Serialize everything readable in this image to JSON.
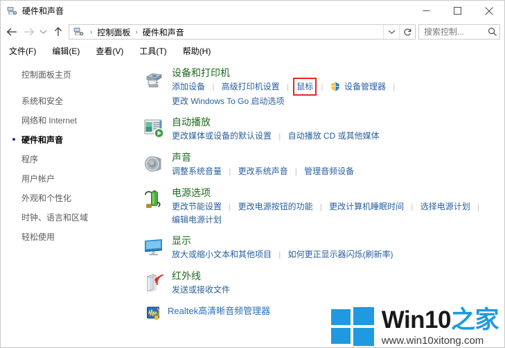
{
  "window": {
    "title": "硬件和声音",
    "title_icon": "devices-printers-icon",
    "controls": {
      "minimize": "minimize-icon",
      "maximize": "maximize-icon",
      "close": "close-icon"
    }
  },
  "addressbar": {
    "back": "back-arrow-icon",
    "forward": "forward-arrow-icon",
    "recent": "chevron-down-icon",
    "up": "up-arrow-icon",
    "crumb_icon": "devices-printers-icon",
    "crumbs": [
      "控制面板",
      "硬件和声音"
    ],
    "separator": "›",
    "dropdown": "chevron-down-icon",
    "refresh": "refresh-icon",
    "search": {
      "value": "",
      "placeholder": "搜索控制...",
      "icon": "search-icon"
    }
  },
  "menubar": {
    "items": [
      "文件(F)",
      "编辑(E)",
      "查看(V)",
      "工具(T)",
      "帮助(H)"
    ]
  },
  "sidebar": {
    "home": "控制面板主页",
    "items": [
      {
        "label": "系统和安全",
        "current": false
      },
      {
        "label": "网络和 Internet",
        "current": false
      },
      {
        "label": "硬件和声音",
        "current": true
      },
      {
        "label": "程序",
        "current": false
      },
      {
        "label": "用户帐户",
        "current": false
      },
      {
        "label": "外观和个性化",
        "current": false
      },
      {
        "label": "时钟、语言和区域",
        "current": false
      },
      {
        "label": "轻松使用",
        "current": false
      }
    ]
  },
  "main": {
    "categories": [
      {
        "title": "设备和打印机",
        "icon": "printer-icon",
        "lines": [
          [
            {
              "text": "添加设备"
            },
            {
              "text": "高级打印机设置"
            },
            {
              "text": "鼠标",
              "highlight": true
            },
            {
              "text": "设备管理器",
              "shield": true
            }
          ],
          [
            {
              "text": "更改 Windows To Go 启动选项"
            }
          ]
        ]
      },
      {
        "title": "自动播放",
        "icon": "autoplay-icon",
        "lines": [
          [
            {
              "text": "更改媒体或设备的默认设置"
            },
            {
              "text": "自动播放 CD 或其他媒体"
            }
          ]
        ]
      },
      {
        "title": "声音",
        "icon": "speaker-icon",
        "lines": [
          [
            {
              "text": "调整系统音量"
            },
            {
              "text": "更改系统声音"
            },
            {
              "text": "管理音频设备"
            }
          ]
        ]
      },
      {
        "title": "电源选项",
        "icon": "battery-icon",
        "lines": [
          [
            {
              "text": "更改节能设置"
            },
            {
              "text": "更改电源按钮的功能"
            },
            {
              "text": "更改计算机睡眠时间"
            },
            {
              "text": "选择电源计划"
            }
          ],
          [
            {
              "text": "编辑电源计划"
            }
          ]
        ]
      },
      {
        "title": "显示",
        "icon": "monitor-icon",
        "lines": [
          [
            {
              "text": "放大或缩小文本和其他项目"
            },
            {
              "text": "如何更正显示器闪烁(刷新率)"
            }
          ]
        ]
      },
      {
        "title": "红外线",
        "icon": "infrared-icon",
        "lines": [
          [
            {
              "text": "发送或接收文件"
            }
          ]
        ]
      }
    ],
    "extra_item": {
      "title": "Realtek高清晰音频管理器",
      "icon": "realtek-audio-icon"
    }
  },
  "watermark": {
    "logo": "windows-logo-icon",
    "brand_en": "Win10",
    "brand_cn": "之家",
    "url": "www.win10xitong.com"
  },
  "colors": {
    "category_title": "#1d6a1d",
    "link": "#2a5f9e",
    "highlight_box": "#e8251f",
    "brand_blue": "#1f9ae0"
  }
}
